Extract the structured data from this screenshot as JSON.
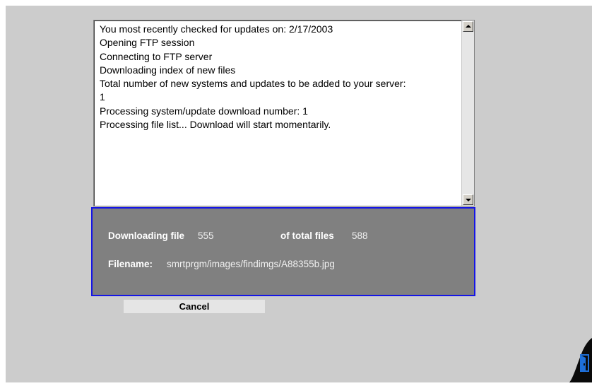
{
  "log": {
    "lines": [
      "You most recently checked for updates on: 2/17/2003",
      "Opening FTP session",
      "Connecting to FTP server",
      "Downloading index of new files",
      "Total number of new systems and updates to be added to your server:",
      "1",
      "Processing system/update download number:  1",
      "Processing file list... Download will start momentarily."
    ]
  },
  "progress": {
    "downloading_label": "Downloading file",
    "downloading_value": "555",
    "total_label": "of total files",
    "total_value": "588",
    "filename_label": "Filename:",
    "filename_value": "smrtprgm/images/findimgs/A88355b.jpg"
  },
  "actions": {
    "cancel_label": "Cancel"
  },
  "colors": {
    "panel_border": "#1515e6",
    "panel_background": "#808080",
    "page_background": "#cccccc",
    "exit_icon": "#1e6fd9"
  },
  "icons": {
    "exit": "exit-door-icon"
  }
}
